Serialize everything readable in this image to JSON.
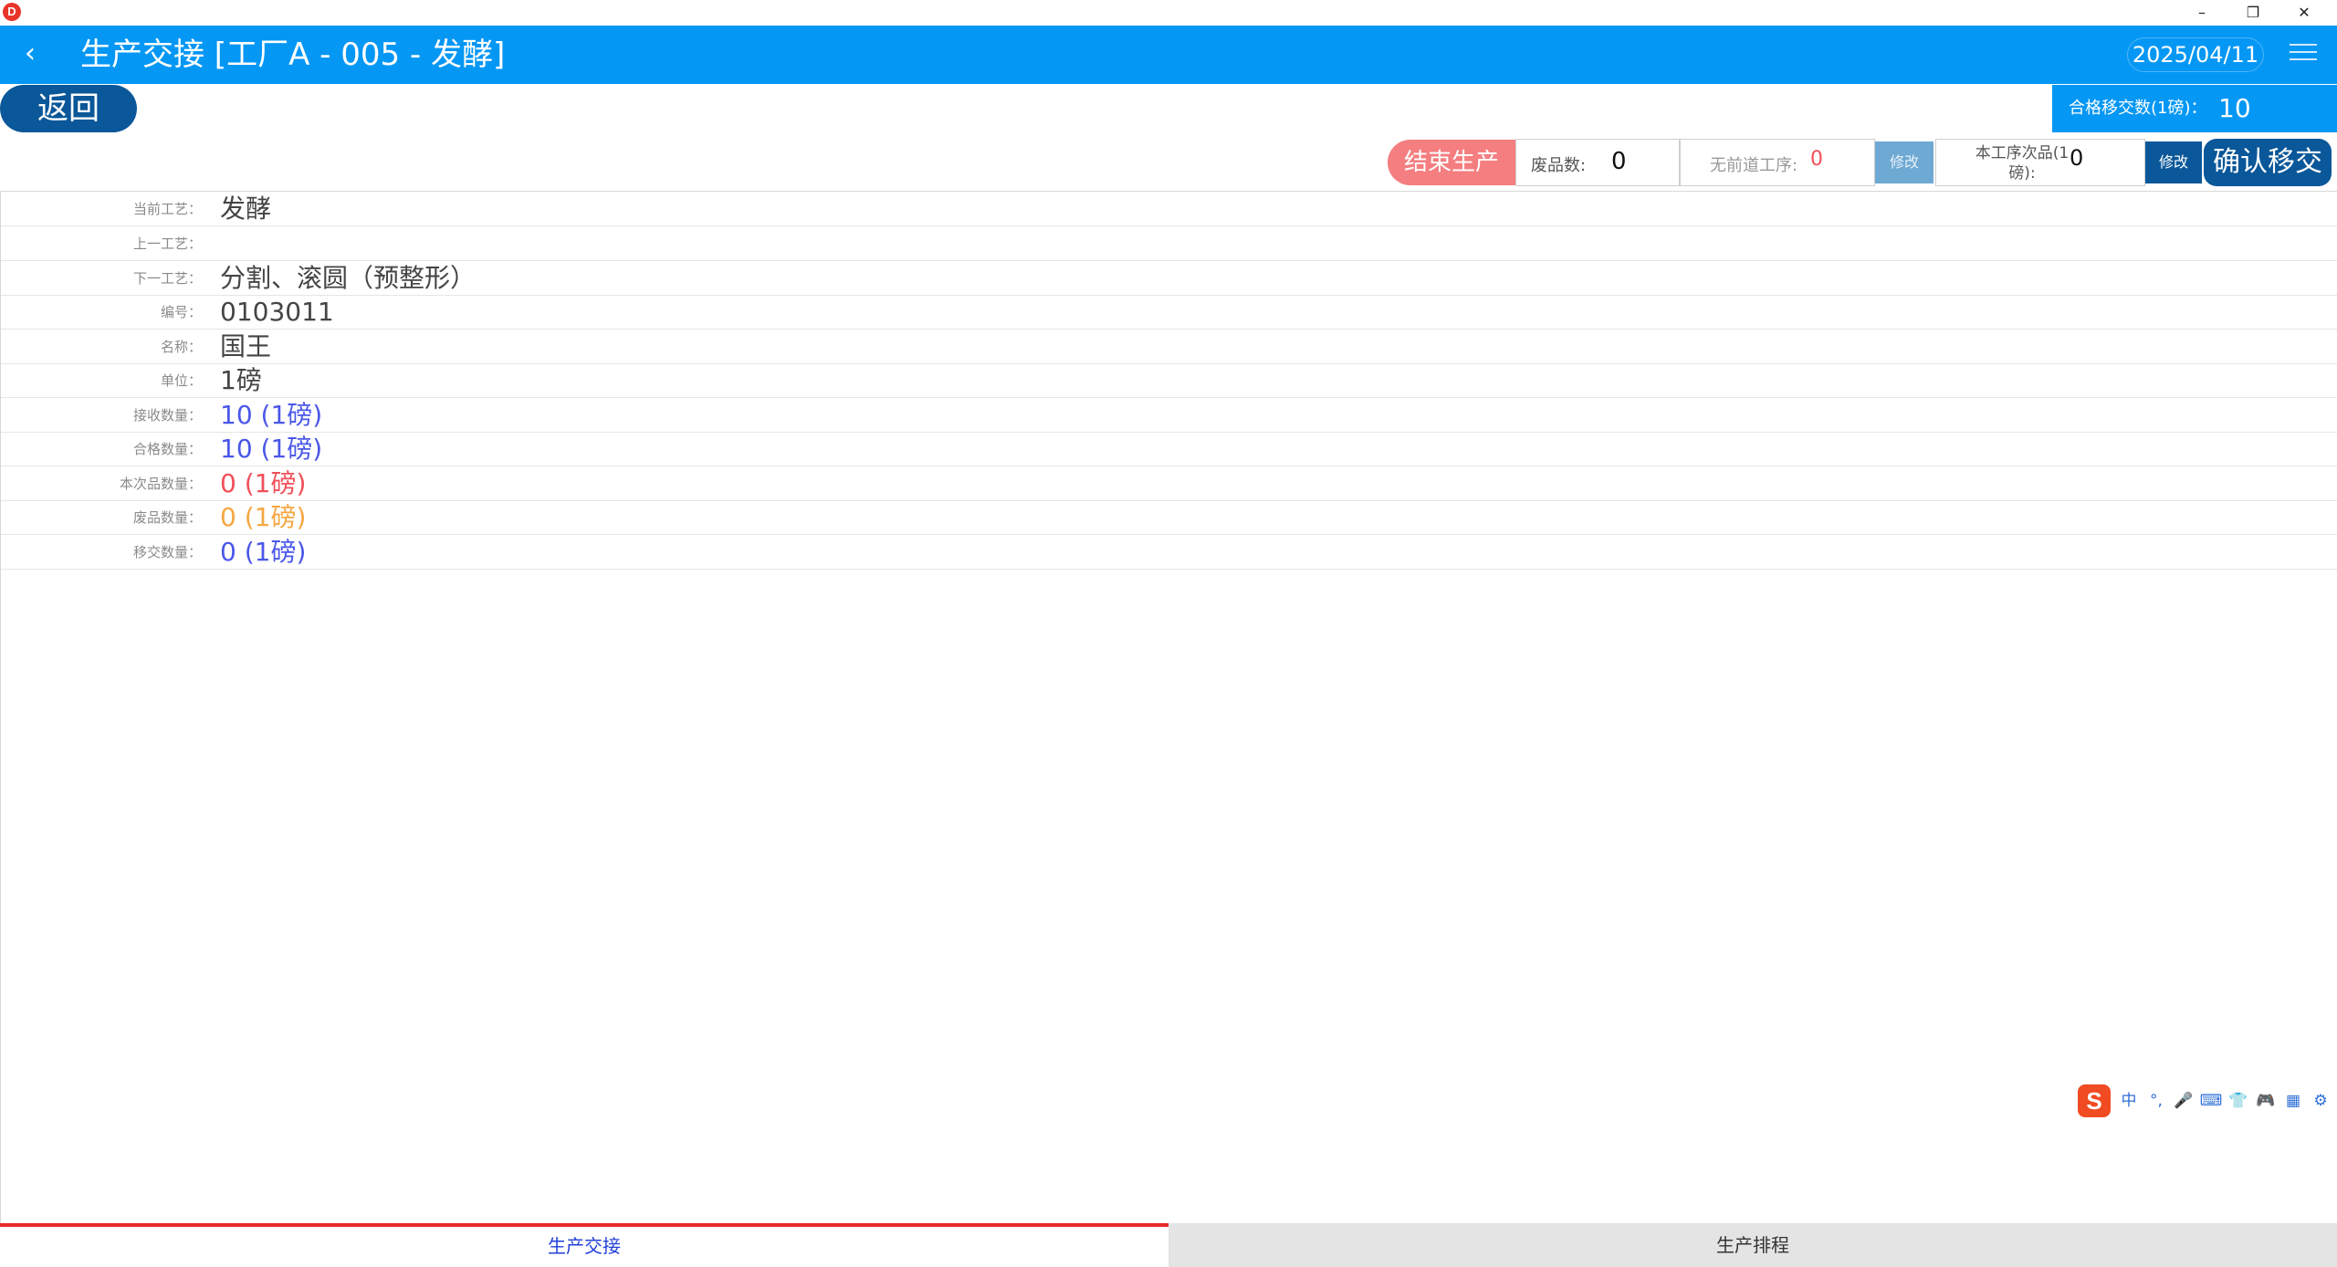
{
  "window": {
    "app_logo": "D",
    "minimize": "–",
    "restore": "❐",
    "close": "✕"
  },
  "header": {
    "back_icon": "‹",
    "title": "生产交接 [工厂A - 005 - 发酵]",
    "date": "2025/04/11",
    "menu_icon": "hamburger-menu"
  },
  "toolbar": {
    "back_label": "返回",
    "qualified_transfer_label": "合格移交数(1磅)：",
    "qualified_transfer_value": "10",
    "end_production_label": "结束生产",
    "scrap_label": "废品数:",
    "scrap_value": "0",
    "no_prev_label": "无前道工序:",
    "no_prev_value": "0",
    "modify_label_1": "修改",
    "defect_label": "本工序次品(1磅):",
    "defect_value": "0",
    "modify_label_2": "修改",
    "confirm_label": "确认移交"
  },
  "details": [
    {
      "label": "当前工艺：",
      "value": "发酵",
      "tone": "gray"
    },
    {
      "label": "上一工艺：",
      "value": "",
      "tone": "gray"
    },
    {
      "label": "下一工艺：",
      "value": "分割、滚圆（预整形）",
      "tone": "gray"
    },
    {
      "label": "编号：",
      "value": "0103011",
      "tone": "gray"
    },
    {
      "label": "名称：",
      "value": "国王",
      "tone": "gray"
    },
    {
      "label": "单位：",
      "value": "1磅",
      "tone": "gray"
    },
    {
      "label": "接收数量：",
      "value": "10 (1磅)",
      "tone": "blue"
    },
    {
      "label": "合格数量：",
      "value": "10 (1磅)",
      "tone": "blue"
    },
    {
      "label": "本次品数量：",
      "value": "0 (1磅)",
      "tone": "red"
    },
    {
      "label": "废品数量：",
      "value": "0 (1磅)",
      "tone": "orange"
    },
    {
      "label": "移交数量：",
      "value": "0 (1磅)",
      "tone": "blue"
    }
  ],
  "ime": {
    "logo": "S",
    "items": [
      "中",
      "°,",
      "🎤",
      "⌨",
      "👕",
      "🎮",
      "▦",
      "⚙"
    ]
  },
  "tabs": {
    "handover": "生产交接",
    "schedule": "生产排程"
  },
  "colors": {
    "header_blue": "#0597f4",
    "dark_blue": "#0a5799",
    "end_button_pink": "#f47e80",
    "value_blue": "#4a57e8",
    "value_red": "#f0505a",
    "value_orange": "#f5a742",
    "active_tab_red": "#e82a2a"
  }
}
